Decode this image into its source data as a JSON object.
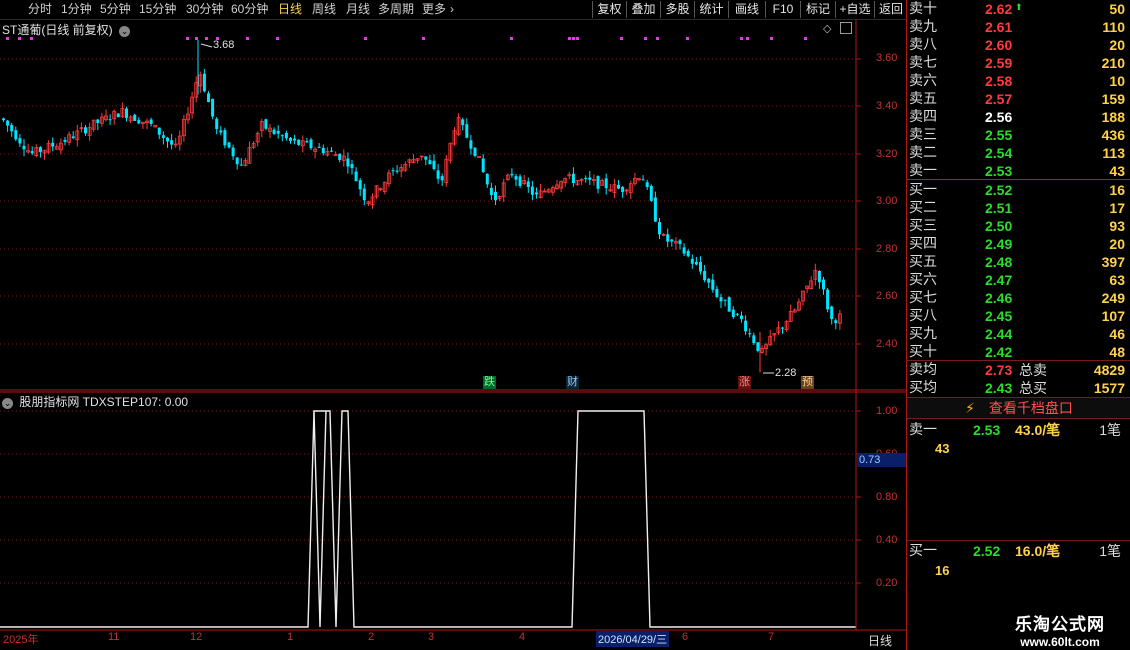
{
  "toolbar": {
    "periods": [
      "分时",
      "1分钟",
      "5分钟",
      "15分钟",
      "30分钟",
      "60分钟",
      "日线",
      "周线",
      "月线",
      "多周期",
      "更多"
    ],
    "active": "日线",
    "buttons": [
      "复权",
      "叠加",
      "多股",
      "统计",
      "画线",
      "F10",
      "标记",
      "+自选",
      "返回"
    ]
  },
  "main_chart": {
    "title": "ST通葡(日线 前复权)",
    "y_ticks": [
      "3.60",
      "3.40",
      "3.20",
      "3.00",
      "2.80",
      "2.60",
      "2.40"
    ],
    "high_label": "3.68",
    "low_label": "2.28",
    "events": [
      "跌",
      "财",
      "涨",
      "预"
    ]
  },
  "indicator": {
    "title": "股朋指标网 TDXSTEP107: 0.00",
    "y_ticks": [
      "1.00",
      "0.80",
      "0.60",
      "0.40",
      "0.20"
    ],
    "cursor_value": "0.73"
  },
  "x_axis": {
    "labels": [
      "2025年",
      "11",
      "12",
      "1",
      "2",
      "3",
      "4",
      "2026/04/29/三",
      "6",
      "7"
    ],
    "period_label": "日线"
  },
  "order_book": {
    "asks": [
      {
        "label": "卖十",
        "price": "2.62",
        "vol": "50",
        "color": "red"
      },
      {
        "label": "卖九",
        "price": "2.61",
        "vol": "110",
        "color": "red"
      },
      {
        "label": "卖八",
        "price": "2.60",
        "vol": "20",
        "color": "red"
      },
      {
        "label": "卖七",
        "price": "2.59",
        "vol": "210",
        "color": "red"
      },
      {
        "label": "卖六",
        "price": "2.58",
        "vol": "10",
        "color": "red"
      },
      {
        "label": "卖五",
        "price": "2.57",
        "vol": "159",
        "color": "red"
      },
      {
        "label": "卖四",
        "price": "2.56",
        "vol": "188",
        "color": "white"
      },
      {
        "label": "卖三",
        "price": "2.55",
        "vol": "436",
        "color": "green"
      },
      {
        "label": "卖二",
        "price": "2.54",
        "vol": "113",
        "color": "green"
      },
      {
        "label": "卖一",
        "price": "2.53",
        "vol": "43",
        "color": "green"
      }
    ],
    "bids": [
      {
        "label": "买一",
        "price": "2.52",
        "vol": "16",
        "color": "green"
      },
      {
        "label": "买二",
        "price": "2.51",
        "vol": "17",
        "color": "green"
      },
      {
        "label": "买三",
        "price": "2.50",
        "vol": "93",
        "color": "green"
      },
      {
        "label": "买四",
        "price": "2.49",
        "vol": "20",
        "color": "green"
      },
      {
        "label": "买五",
        "price": "2.48",
        "vol": "397",
        "color": "green"
      },
      {
        "label": "买六",
        "price": "2.47",
        "vol": "63",
        "color": "green"
      },
      {
        "label": "买七",
        "price": "2.46",
        "vol": "249",
        "color": "green"
      },
      {
        "label": "买八",
        "price": "2.45",
        "vol": "107",
        "color": "green"
      },
      {
        "label": "买九",
        "price": "2.44",
        "vol": "46",
        "color": "green"
      },
      {
        "label": "买十",
        "price": "2.42",
        "vol": "48",
        "color": "green"
      }
    ],
    "ask_avg": {
      "label": "卖均",
      "price": "2.73",
      "total_label": "总卖",
      "total": "4829"
    },
    "bid_avg": {
      "label": "买均",
      "price": "2.43",
      "total_label": "总买",
      "total": "1577"
    },
    "thousand_btn": "查看千档盘口",
    "ask1_detail": {
      "label": "卖一",
      "price": "2.53",
      "amount": "43.0/笔",
      "count": "1笔",
      "queue": "43"
    },
    "bid1_detail": {
      "label": "买一",
      "price": "2.52",
      "amount": "16.0/笔",
      "count": "1笔",
      "queue": "16"
    }
  },
  "watermark": {
    "name": "乐淘公式网",
    "url": "www.60lt.com"
  },
  "colors": {
    "up": "#ff3b3b",
    "down": "#00e5ff",
    "frame": "#b01818",
    "grid": "#7a1a1a",
    "accent": "#ffd24a"
  }
}
